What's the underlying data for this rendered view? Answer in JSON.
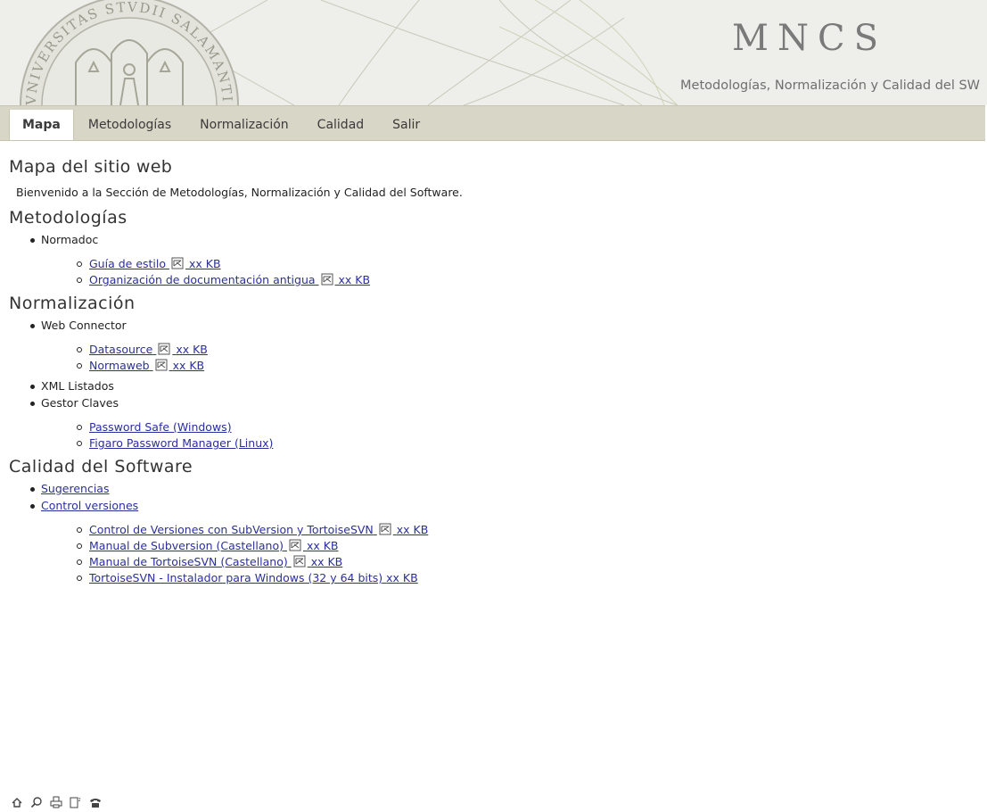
{
  "header": {
    "title": "MNCS",
    "subtitle": "Metodologías, Normalización y Calidad del SW",
    "seal_text": "VNIVERSITAS STVDII SALAMANTINI"
  },
  "nav": {
    "tabs": [
      "Mapa",
      "Metodologías",
      "Normalización",
      "Calidad",
      "Salir"
    ],
    "active": "Mapa"
  },
  "page": {
    "title": "Mapa del sitio web",
    "intro": "Bienvenido a la Sección de Metodologías, Normalización y Calidad del Software."
  },
  "sections": [
    {
      "title": "Metodologías",
      "groups": [
        {
          "label": "Normadoc",
          "link": false,
          "items": [
            {
              "label": "Guía de estilo",
              "pdf": true,
              "size": "xx KB"
            },
            {
              "label": "Organización de documentación antigua",
              "pdf": true,
              "size": "xx KB"
            }
          ]
        }
      ]
    },
    {
      "title": "Normalización",
      "groups": [
        {
          "label": "Web Connector",
          "link": false,
          "items": [
            {
              "label": "Datasource",
              "pdf": true,
              "size": "xx KB"
            },
            {
              "label": "Normaweb",
              "pdf": true,
              "size": "xx KB"
            }
          ]
        },
        {
          "label": "XML Listados",
          "link": false,
          "items": []
        },
        {
          "label": "Gestor Claves",
          "link": false,
          "items": [
            {
              "label": "Password Safe (Windows)",
              "pdf": false,
              "size": ""
            },
            {
              "label": "Figaro Password Manager (Linux)",
              "pdf": false,
              "size": ""
            }
          ]
        }
      ]
    },
    {
      "title": "Calidad del Software",
      "groups": [
        {
          "label": "Sugerencias",
          "link": true,
          "items": []
        },
        {
          "label": "Control versiones",
          "link": true,
          "items": [
            {
              "label": "Control de Versiones con SubVersion y TortoiseSVN",
              "pdf": true,
              "size": "xx KB"
            },
            {
              "label": "Manual de Subversion (Castellano)",
              "pdf": true,
              "size": "xx KB"
            },
            {
              "label": "Manual de TortoiseSVN (Castellano)",
              "pdf": true,
              "size": "xx KB"
            },
            {
              "label": "TortoiseSVN - Instalador para Windows (32 y 64 bits)",
              "pdf": false,
              "size": "xx KB"
            }
          ]
        }
      ]
    }
  ],
  "footer": {
    "icons": [
      "home-icon",
      "search-icon",
      "print-icon",
      "document-size-icon",
      "phone-icon"
    ]
  },
  "colors": {
    "header_bg": "#eeeeea",
    "nav_bg": "#d8d6c6",
    "link": "#2b2f9e",
    "title_gray": "#7a7a7a"
  }
}
